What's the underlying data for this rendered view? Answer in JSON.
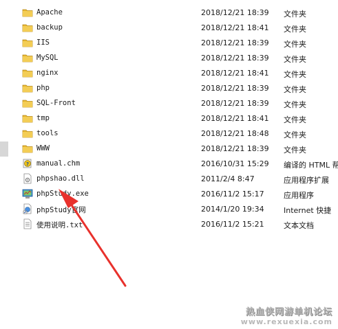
{
  "files": [
    {
      "name": "Apache",
      "date": "2018/12/21 18:39",
      "type": "文件夹",
      "icon": "folder-icon"
    },
    {
      "name": "backup",
      "date": "2018/12/21 18:41",
      "type": "文件夹",
      "icon": "folder-icon"
    },
    {
      "name": "IIS",
      "date": "2018/12/21 18:39",
      "type": "文件夹",
      "icon": "folder-icon"
    },
    {
      "name": "MySQL",
      "date": "2018/12/21 18:39",
      "type": "文件夹",
      "icon": "folder-icon"
    },
    {
      "name": "nginx",
      "date": "2018/12/21 18:41",
      "type": "文件夹",
      "icon": "folder-icon"
    },
    {
      "name": "php",
      "date": "2018/12/21 18:39",
      "type": "文件夹",
      "icon": "folder-icon"
    },
    {
      "name": "SQL-Front",
      "date": "2018/12/21 18:39",
      "type": "文件夹",
      "icon": "folder-icon"
    },
    {
      "name": "tmp",
      "date": "2018/12/21 18:41",
      "type": "文件夹",
      "icon": "folder-icon"
    },
    {
      "name": "tools",
      "date": "2018/12/21 18:48",
      "type": "文件夹",
      "icon": "folder-icon"
    },
    {
      "name": "WWW",
      "date": "2018/12/21 18:39",
      "type": "文件夹",
      "icon": "folder-icon"
    },
    {
      "name": "manual.chm",
      "date": "2016/10/31 15:29",
      "type": "编译的 HTML 帮",
      "icon": "chm-help-icon"
    },
    {
      "name": "phpshao.dll",
      "date": "2011/2/4 8:47",
      "type": "应用程序扩展",
      "icon": "dll-file-icon"
    },
    {
      "name": "phpStudy.exe",
      "date": "2016/11/2 15:17",
      "type": "应用程序",
      "icon": "exe-app-icon"
    },
    {
      "name": "phpStudy官网",
      "date": "2014/1/20 19:34",
      "type": "Internet 快捷",
      "icon": "internet-shortcut-icon"
    },
    {
      "name": "使用说明.txt",
      "date": "2016/11/2 15:21",
      "type": "文本文档",
      "icon": "text-file-icon"
    }
  ],
  "watermark": {
    "title": "热血侠网游单机论坛",
    "url": "www.rexuexia.com"
  },
  "colors": {
    "folder": "#e8b830",
    "arrow": "#e8312c",
    "text": "#1a1a1a"
  }
}
